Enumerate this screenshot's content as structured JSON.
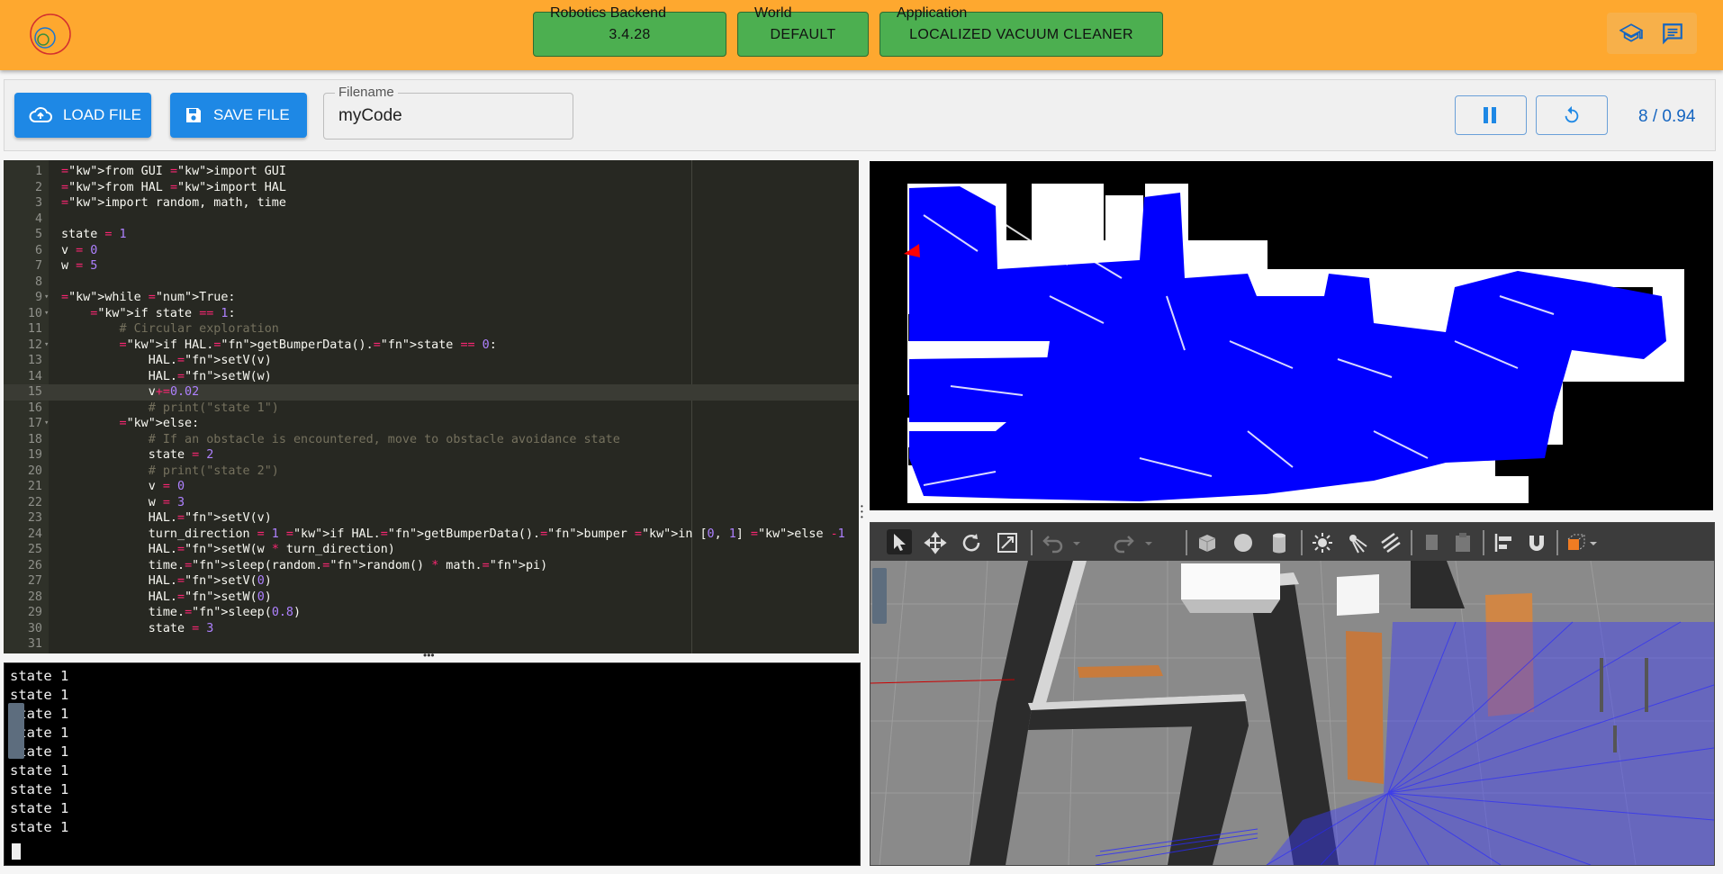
{
  "header": {
    "robotics_backend": {
      "label": "Robotics Backend",
      "value": "3.4.28"
    },
    "world": {
      "label": "World",
      "value": "DEFAULT"
    },
    "application": {
      "label": "Application",
      "value": "LOCALIZED VACUUM CLEANER"
    },
    "icons": [
      "graduation-cap-icon",
      "chat-icon"
    ],
    "accent": "#fea82f",
    "pill_color": "#4caf50"
  },
  "toolbar": {
    "load_label": "LOAD FILE",
    "save_label": "SAVE FILE",
    "filename_label": "Filename",
    "filename_value": "myCode",
    "stats": "8 / 0.94",
    "button_color": "#1e88e5"
  },
  "editor": {
    "lines": [
      {
        "n": "1",
        "t": "from GUI import GUI"
      },
      {
        "n": "2",
        "t": "from HAL import HAL"
      },
      {
        "n": "3",
        "t": "import random, math, time"
      },
      {
        "n": "4",
        "t": ""
      },
      {
        "n": "5",
        "t": "state = 1"
      },
      {
        "n": "6",
        "t": "v = 0"
      },
      {
        "n": "7",
        "t": "w = 5"
      },
      {
        "n": "8",
        "t": ""
      },
      {
        "n": "9",
        "t": "while True:"
      },
      {
        "n": "10",
        "t": "    if state == 1:"
      },
      {
        "n": "11",
        "t": "        # Circular exploration"
      },
      {
        "n": "12",
        "t": "        if HAL.getBumperData().state == 0:"
      },
      {
        "n": "13",
        "t": "            HAL.setV(v)"
      },
      {
        "n": "14",
        "t": "            HAL.setW(w)"
      },
      {
        "n": "15",
        "t": "            v+=0.02"
      },
      {
        "n": "16",
        "t": "            # print(\"state 1\")"
      },
      {
        "n": "17",
        "t": "        else:"
      },
      {
        "n": "18",
        "t": "            # If an obstacle is encountered, move to obstacle avoidance state"
      },
      {
        "n": "19",
        "t": "            state = 2"
      },
      {
        "n": "20",
        "t": "            # print(\"state 2\")"
      },
      {
        "n": "21",
        "t": "            v = 0"
      },
      {
        "n": "22",
        "t": "            w = 3"
      },
      {
        "n": "23",
        "t": "            HAL.setV(v)"
      },
      {
        "n": "24",
        "t": "            turn_direction = 1 if HAL.getBumperData().bumper in [0, 1] else -1"
      },
      {
        "n": "25",
        "t": "            HAL.setW(w * turn_direction)"
      },
      {
        "n": "26",
        "t": "            time.sleep(random.random() * math.pi)"
      },
      {
        "n": "27",
        "t": "            HAL.setV(0)"
      },
      {
        "n": "28",
        "t": "            HAL.setW(0)"
      },
      {
        "n": "29",
        "t": "            time.sleep(0.8)"
      },
      {
        "n": "30",
        "t": "            state = 3"
      },
      {
        "n": "31",
        "t": ""
      }
    ],
    "fold_lines": [
      "9",
      "10",
      "12",
      "17"
    ],
    "active_line": "15",
    "zoom_in": "+",
    "zoom_out": "−"
  },
  "console": {
    "lines": [
      "state 1",
      "state 1",
      "state 1",
      "state 1",
      "state 1",
      "state 1",
      "state 1",
      "state 1",
      "state 1"
    ]
  },
  "map": {
    "robot_color": "#ff0000",
    "path_color": "#0000ff"
  }
}
